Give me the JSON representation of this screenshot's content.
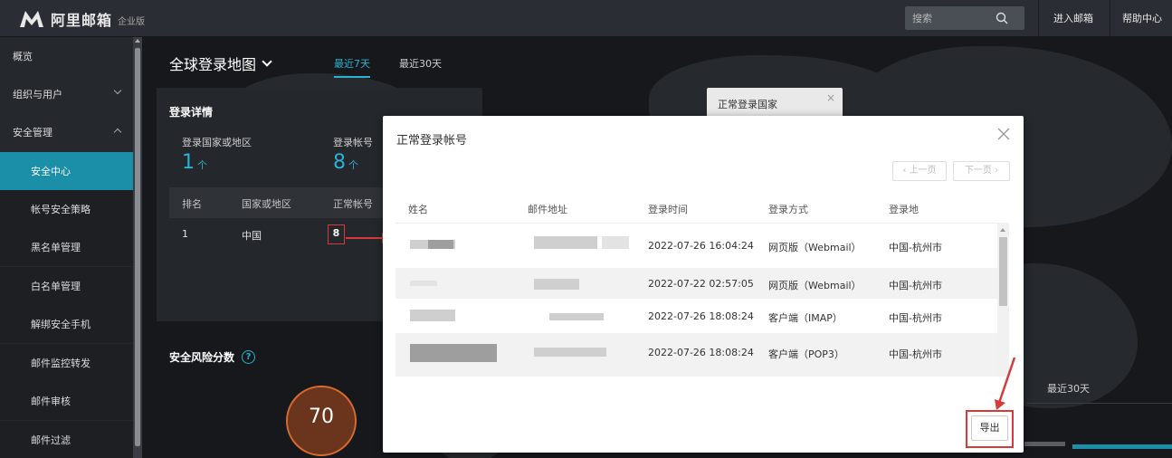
{
  "brand": {
    "name": "阿里邮箱",
    "sub": "企业版"
  },
  "header": {
    "search_placeholder": "搜索",
    "links": [
      "进入邮箱",
      "帮助中心"
    ]
  },
  "sidebar": {
    "items": [
      {
        "label": "概览",
        "level": "top"
      },
      {
        "label": "组织与用户",
        "level": "top",
        "chevron": "down"
      },
      {
        "label": "安全管理",
        "level": "top",
        "chevron": "up"
      },
      {
        "label": "安全中心",
        "level": "sub",
        "active": true
      },
      {
        "label": "帐号安全策略",
        "level": "sub"
      },
      {
        "label": "黑名单管理",
        "level": "sub"
      },
      {
        "label": "白名单管理",
        "level": "sub"
      },
      {
        "label": "解绑安全手机",
        "level": "sub"
      },
      {
        "label": "邮件监控转发",
        "level": "sub"
      },
      {
        "label": "邮件审核",
        "level": "sub"
      },
      {
        "label": "邮件过滤",
        "level": "sub"
      }
    ]
  },
  "map": {
    "title": "全球登录地图",
    "tabs": [
      "最近7天",
      "最近30天"
    ],
    "active_tab": 0
  },
  "login_panel": {
    "title": "登录详情",
    "stats": [
      {
        "label": "登录国家或地区",
        "value": "1",
        "unit": "个"
      },
      {
        "label": "登录帐号",
        "value": "8",
        "unit": "个"
      }
    ],
    "columns": [
      "排名",
      "国家或地区",
      "正常帐号"
    ],
    "rows": [
      {
        "rank": "1",
        "region": "中国",
        "count": "8"
      }
    ]
  },
  "risk": {
    "title": "安全风险分数",
    "score": "70"
  },
  "bg_popup": {
    "title": "正常登录国家"
  },
  "bg_tab30": "最近30天",
  "modal": {
    "title": "正常登录帐号",
    "prev": "‹ 上一页",
    "next": "下一页 ›",
    "columns": [
      "姓名",
      "邮件地址",
      "登录时间",
      "登录方式",
      "登录地"
    ],
    "rows": [
      {
        "time": "2022-07-26 16:04:24",
        "method": "网页版（Webmail）",
        "place": "中国-杭州市"
      },
      {
        "time": "2022-07-22 02:57:05",
        "method": "网页版（Webmail）",
        "place": "中国-杭州市"
      },
      {
        "time": "2022-07-26 18:08:24",
        "method": "客户端（IMAP）",
        "place": "中国-杭州市"
      },
      {
        "time": "2022-07-26 18:08:24",
        "method": "客户端（POP3）",
        "place": "中国-杭州市"
      }
    ],
    "export": "导出"
  },
  "colors": {
    "accent": "#2ab2d3",
    "active_bg": "#1b8ea8",
    "annotation": "#d83a3a"
  }
}
